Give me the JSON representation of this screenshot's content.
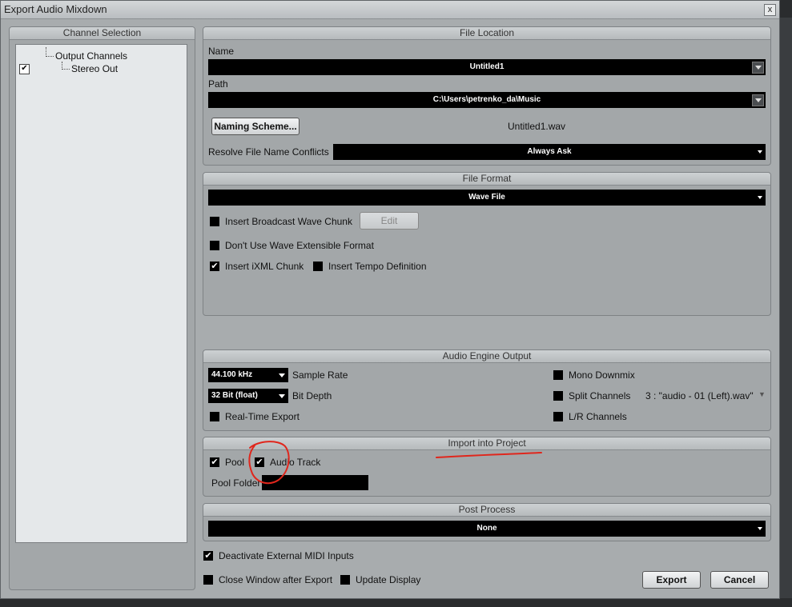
{
  "window": {
    "title": "Export Audio Mixdown",
    "close_glyph": "x"
  },
  "channel_selection": {
    "header": "Channel Selection",
    "tree": [
      {
        "label": "Output Channels"
      },
      {
        "label": "Stereo Out",
        "checked": true
      }
    ]
  },
  "file_location": {
    "header": "File Location",
    "name_label": "Name",
    "name_value": "Untitled1",
    "path_label": "Path",
    "path_value": "C:\\Users\\petrenko_da\\Music",
    "naming_scheme_button": "Naming Scheme...",
    "filename_preview": "Untitled1.wav",
    "conflicts_label": "Resolve File Name Conflicts",
    "conflicts_value": "Always Ask"
  },
  "file_format": {
    "header": "File Format",
    "format_value": "Wave File",
    "broadcast_label": "Insert Broadcast Wave Chunk",
    "broadcast_checked": false,
    "edit_button": "Edit",
    "extensible_label": "Don't Use Wave Extensible Format",
    "extensible_checked": false,
    "ixml_label": "Insert iXML Chunk",
    "ixml_checked": true,
    "tempo_label": "Insert Tempo Definition",
    "tempo_checked": false
  },
  "audio_engine": {
    "header": "Audio Engine Output",
    "sample_rate_value": "44.100 kHz",
    "sample_rate_label": "Sample Rate",
    "bit_depth_value": "32 Bit (float)",
    "bit_depth_label": "Bit Depth",
    "realtime_label": "Real-Time Export",
    "realtime_checked": false,
    "mono_label": "Mono Downmix",
    "mono_checked": false,
    "split_label": "Split Channels",
    "split_checked": false,
    "split_value": "3 : \"audio - 01 (Left).wav\"",
    "lr_label": "L/R Channels",
    "lr_checked": false
  },
  "import_project": {
    "header": "Import into Project",
    "pool_label": "Pool",
    "pool_checked": true,
    "audio_track_label": "Audio Track",
    "audio_track_checked": true,
    "pool_folder_label": "Pool Folder",
    "pool_folder_value": ""
  },
  "post_process": {
    "header": "Post Process",
    "value": "None"
  },
  "footer": {
    "deactivate_midi_label": "Deactivate External MIDI Inputs",
    "deactivate_midi_checked": true,
    "close_window_label": "Close Window after Export",
    "close_window_checked": false,
    "update_display_label": "Update Display",
    "update_display_checked": false,
    "export_button": "Export",
    "cancel_button": "Cancel"
  },
  "annotation_color": "#e0261c"
}
